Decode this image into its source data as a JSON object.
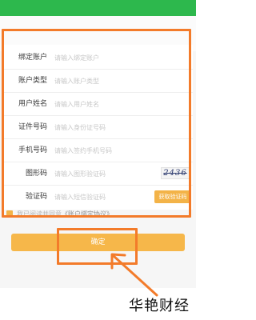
{
  "header": {
    "tabs": [
      "",
      ""
    ]
  },
  "notice": {
    "text": ""
  },
  "form": {
    "rows": [
      {
        "label": "绑定账户",
        "placeholder": "请输入绑定账户"
      },
      {
        "label": "账户类型",
        "placeholder": "请输入账户类型"
      },
      {
        "label": "用户姓名",
        "placeholder": "请输入用户姓名"
      },
      {
        "label": "证件号码",
        "placeholder": "请输入身份证号码"
      },
      {
        "label": "手机号码",
        "placeholder": "请输入签约手机号码"
      },
      {
        "label": "图形码",
        "placeholder": "请输入图形验证码"
      },
      {
        "label": "验证码",
        "placeholder": "请输入短信验证码"
      }
    ],
    "captcha_text": "2436",
    "get_code_label": "获取验证码"
  },
  "agreement": {
    "prefix": "我已阅读并同意",
    "link": "《账户绑定协议》"
  },
  "confirm_label": "确定",
  "watermark": "华艳财经",
  "colors": {
    "header": "#2db84d",
    "accent": "#f6b74a",
    "highlight": "#f37b2a"
  },
  "icons": {
    "arrow": "arrow-pointer-icon"
  }
}
